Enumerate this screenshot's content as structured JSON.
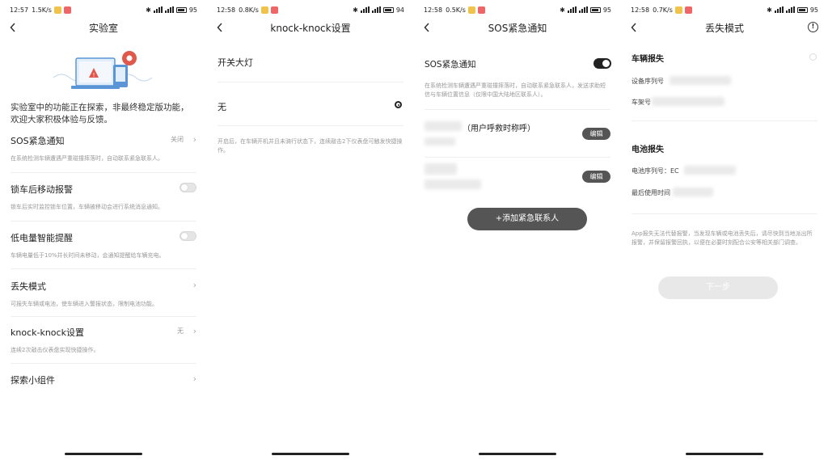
{
  "phones": [
    {
      "status": {
        "time": "12:57",
        "speed": "1.5K/s",
        "battery": "95"
      },
      "title": "实验室",
      "intro": "实验室中的功能正在探索，非最终稳定版功能，欢迎大家积极体验与反馈。",
      "rows": [
        {
          "title": "SOS紧急通知",
          "value": "关闭",
          "desc": "在系统检测车辆遭遇严重碰撞摔落时，自动联系紧急联系人。",
          "control": "chevron"
        },
        {
          "title": "锁车后移动报警",
          "value": "",
          "desc": "锁车后实时监控锁车位置，车辆被移动会进行系统消息通知。",
          "control": "toggle"
        },
        {
          "title": "低电量智能提醒",
          "value": "",
          "desc": "车辆电量低于10%并长时间未移动，会通知提醒给车辆充电。",
          "control": "toggle"
        },
        {
          "title": "丢失模式",
          "value": "",
          "desc": "可报失车辆或电池，使车辆进入警报状态，限制电池功能。",
          "control": "chevron"
        },
        {
          "title": "knock-knock设置",
          "value": "无",
          "desc": "连续2次敲击仪表盘实现快捷操作。",
          "control": "chevron"
        },
        {
          "title": "探索小组件",
          "value": "",
          "desc": "",
          "control": "chevron"
        }
      ]
    },
    {
      "status": {
        "time": "12:58",
        "speed": "0.8K/s",
        "battery": "94"
      },
      "title": "knock-knock设置",
      "options": [
        "开关大灯",
        "无"
      ],
      "note": "开启后，在车辆开机并且未骑行状态下，连续敲击2下仪表盘可触发快捷操作。"
    },
    {
      "status": {
        "time": "12:58",
        "speed": "0.5K/s",
        "battery": "95"
      },
      "title": "SOS紧急通知",
      "sos_label": "SOS紧急通知",
      "sos_desc": "在系统检测车辆遭遇严重碰撞摔落时，自动联系紧急联系人，发送求助短信与车辆位置信息（仅限中国大陆地区联系人）。",
      "contact1_label": "（用户呼救时称呼）",
      "edit_label": "编辑",
      "add_label": "+添加紧急联系人"
    },
    {
      "status": {
        "time": "12:58",
        "speed": "0.7K/s",
        "battery": "95"
      },
      "title": "丢失模式",
      "vehicle_section": "车辆报失",
      "device_serial": "设备序列号",
      "frame_no": "车架号",
      "battery_section": "电池报失",
      "battery_serial": "电池序列号：EC",
      "last_used": "最后使用时间",
      "note": "App报失无法代替报警，当发现车辆或电池丢失后，请尽快到当地派出所报警，并保留报警回执，以便在必要时刻配合公安等相关部门调查。",
      "next_label": "下一步"
    }
  ],
  "colors": {
    "accent": "#222222",
    "muted": "#999999",
    "edit_bg": "#555555",
    "next_disabled": "#e8e8e8"
  }
}
